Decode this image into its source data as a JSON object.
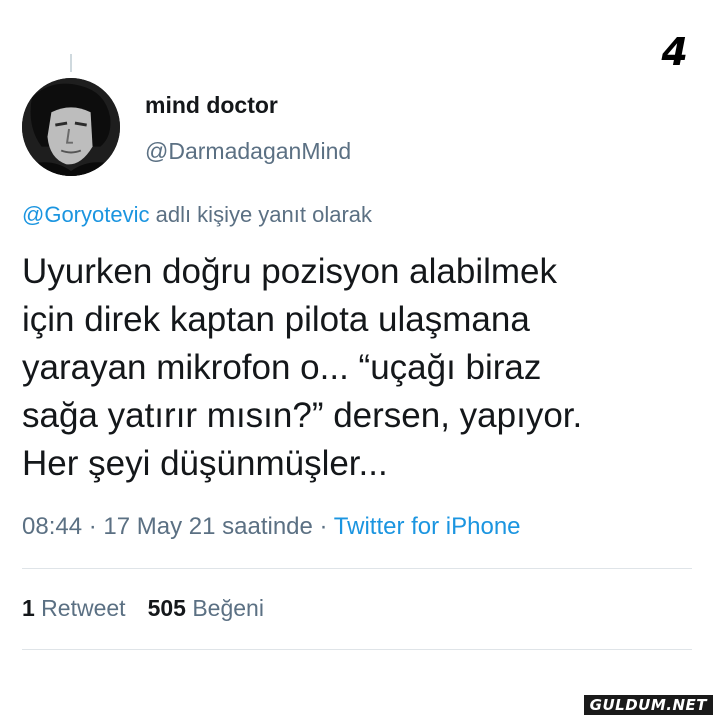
{
  "corner_number": "4",
  "author": {
    "display_name": "mind doctor",
    "handle": "@DarmadaganMind"
  },
  "reply_context": {
    "mention": "@Goryotevic",
    "suffix": " adlı kişiye yanıt olarak"
  },
  "tweet": {
    "lines": [
      "Uyurken doğru pozisyon alabilmek",
      "için direk kaptan pilota ulaşmana",
      "yarayan mikrofon o... “uçağı biraz",
      "sağa yatırır mısın?” dersen, yapıyor.",
      "Her şeyi düşünmüşler..."
    ]
  },
  "meta": {
    "time": "08:44",
    "separator": " · ",
    "date": "17 May 21 saatinde",
    "source": "Twitter for iPhone"
  },
  "stats": {
    "retweets_count": "1",
    "retweets_label": " Retweet",
    "likes_count": "505",
    "likes_label": " Beğeni"
  },
  "watermark": "GULDUM.NET",
  "colors": {
    "link": "#1b95e0",
    "secondary_text": "#5b7083",
    "primary_text": "#14171a",
    "divider": "#dfe4e8"
  }
}
